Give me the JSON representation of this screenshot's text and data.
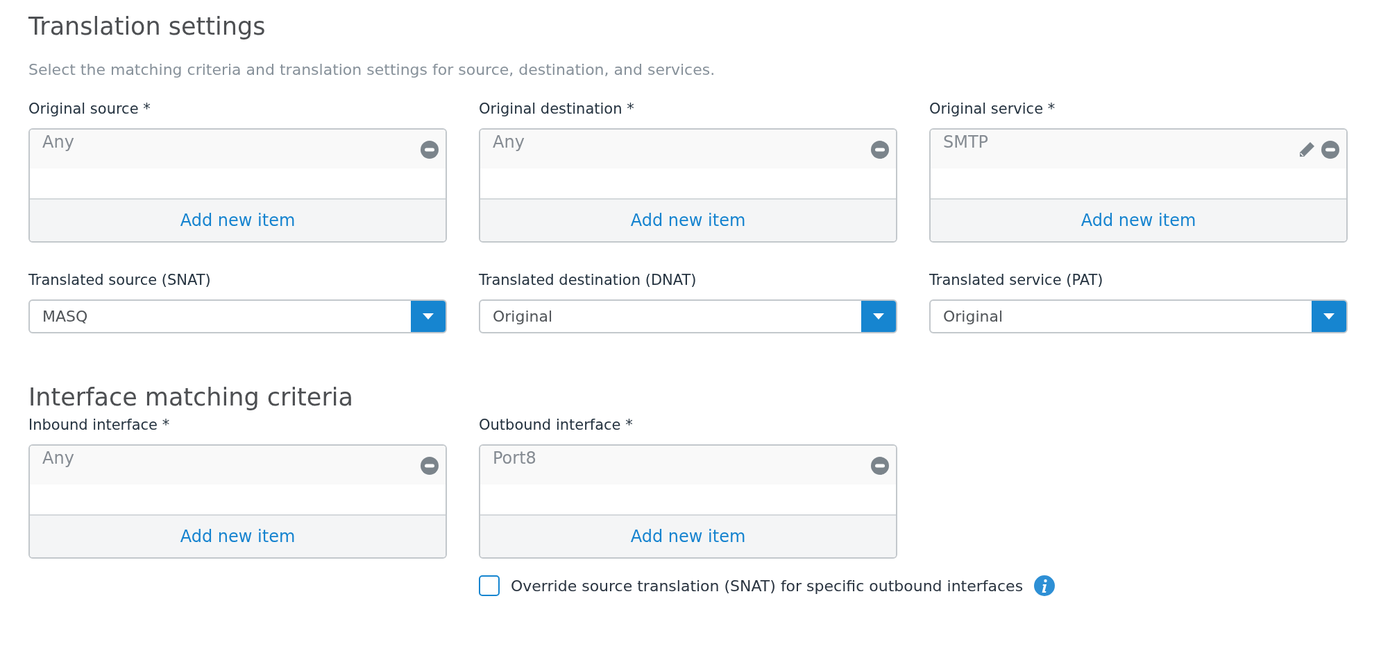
{
  "translation": {
    "title": "Translation settings",
    "description": "Select the matching criteria and translation settings for source, destination, and services.",
    "lists": [
      {
        "label": "Original source *",
        "items": [
          {
            "text": "Any",
            "editable": false
          }
        ],
        "add": "Add new item"
      },
      {
        "label": "Original destination *",
        "items": [
          {
            "text": "Any",
            "editable": false
          }
        ],
        "add": "Add new item"
      },
      {
        "label": "Original service *",
        "items": [
          {
            "text": "SMTP",
            "editable": true
          }
        ],
        "add": "Add new item"
      }
    ],
    "selects": [
      {
        "label": "Translated source (SNAT)",
        "value": "MASQ"
      },
      {
        "label": "Translated destination (DNAT)",
        "value": "Original"
      },
      {
        "label": "Translated service (PAT)",
        "value": "Original"
      }
    ]
  },
  "interfaces": {
    "title": "Interface matching criteria",
    "lists": [
      {
        "label": "Inbound interface *",
        "items": [
          {
            "text": "Any",
            "editable": false
          }
        ],
        "add": "Add new item"
      },
      {
        "label": "Outbound interface *",
        "items": [
          {
            "text": "Port8",
            "editable": false
          }
        ],
        "add": "Add new item"
      }
    ],
    "override": {
      "label": "Override source translation (SNAT) for specific outbound interfaces",
      "checked": false
    }
  }
}
